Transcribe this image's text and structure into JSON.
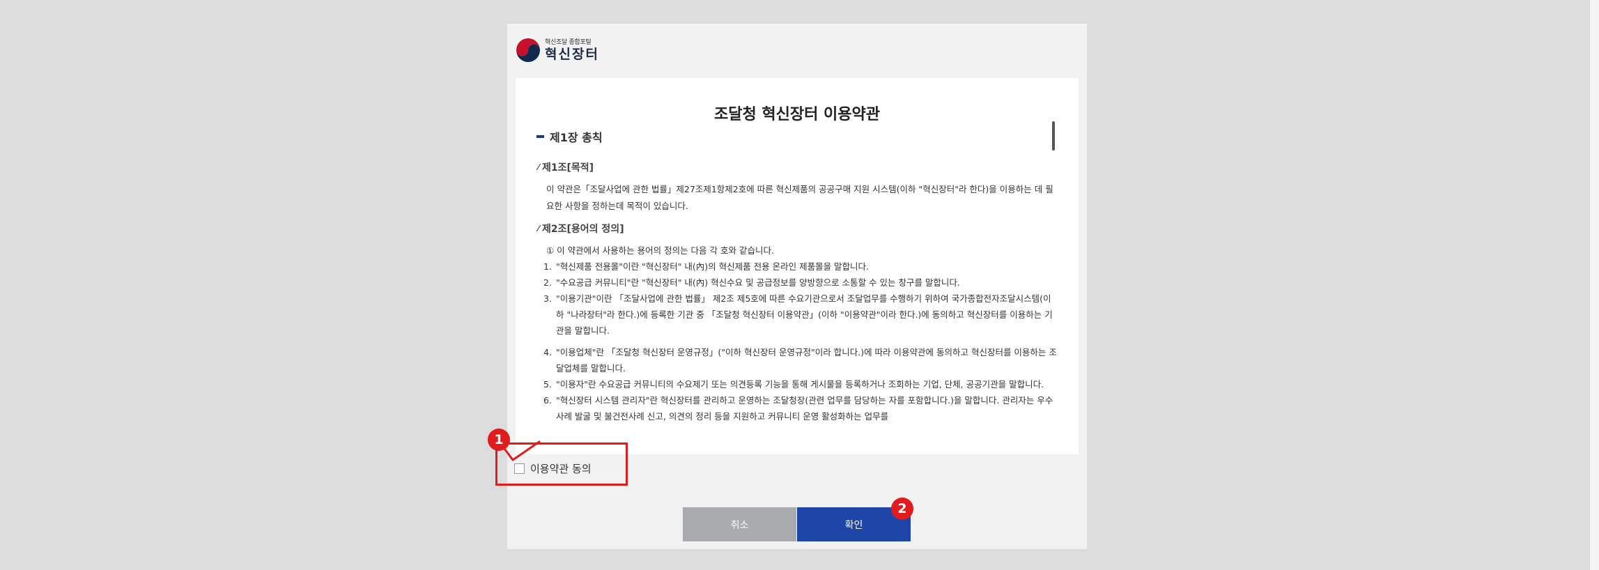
{
  "logo": {
    "subtitle": "혁신조달 종합포털",
    "name": "혁신장터",
    "icon": "taegeuk-emblem-icon"
  },
  "terms": {
    "title": "조달청 혁신장터 이용약관",
    "chapter": "제1장 총칙",
    "article1": {
      "title": "제1조[목적]",
      "body": "이 약관은「조달사업에 관한 법률」제27조제1항제2호에 따른 혁신제품의 공공구매 지원 시스템(이하 \"혁신장터\"라 한다)을 이용하는 데 필요한 사항을 정하는데 목적이 있습니다."
    },
    "article2": {
      "title": "제2조[용어의 정의]",
      "intro": "① 이 약관에서 사용하는 용어의 정의는 다음 각 호와 같습니다.",
      "items": [
        {
          "num": "1.",
          "text": "\"혁신제품 전용몰\"이란 \"혁신장터\" 내(內)의 혁신제품 전용 온라인 제품몰을 말합니다."
        },
        {
          "num": "2.",
          "text": "\"수요공급 커뮤니티\"란 \"혁신장터\" 내(內) 혁신수요 및 공급정보를 양방향으로 소통할 수 있는 창구를 말합니다."
        },
        {
          "num": "3.",
          "text": "\"이용기관\"이란 「조달사업에 관한 법률」 제2조 제5호에 따른 수요기관으로서 조달업무를 수행하기 위하여 국가종합전자조달시스템(이하 \"나라장터\"라 한다.)에 등록한 기관 중 「조달청 혁신장터 이용약관」(이하 \"이용약관\"이라 한다.)에 동의하고 혁신장터를 이용하는 기관을 말합니다."
        },
        {
          "num": "4.",
          "text": "\"이용업체\"란 「조달청 혁신장터 운영규정」(\"이하 혁신장터 운영규정\"이라 합니다.)에 따라 이용약관에 동의하고 혁신장터를 이용하는 조달업체를 말합니다."
        },
        {
          "num": "5.",
          "text": "\"이용자\"란 수요공급 커뮤니티의 수요제기 또는 의견등록 기능을 통해 게시물을 등록하거나 조회하는 기업, 단체, 공공기관을 말합니다."
        },
        {
          "num": "6.",
          "text": "\"혁신장터 시스템 관리자\"란 혁신장터를 관리하고 운영하는 조달청장(관련 업무를 담당하는 자를 포함합니다.)을 말합니다. 관리자는 우수사례 발굴 및 불건전사례 신고, 의견의 정리 등을 지원하고 커뮤니티 운영 활성화하는 업무를"
        }
      ]
    }
  },
  "agree": {
    "label": "이용약관 동의",
    "checked": false
  },
  "buttons": {
    "cancel": "취소",
    "confirm": "확인"
  },
  "annotations": {
    "badge1": "1",
    "badge2": "2"
  },
  "colors": {
    "confirm": "#1e45a8",
    "cancel": "#a9aaad",
    "highlight": "#e21c1c"
  }
}
